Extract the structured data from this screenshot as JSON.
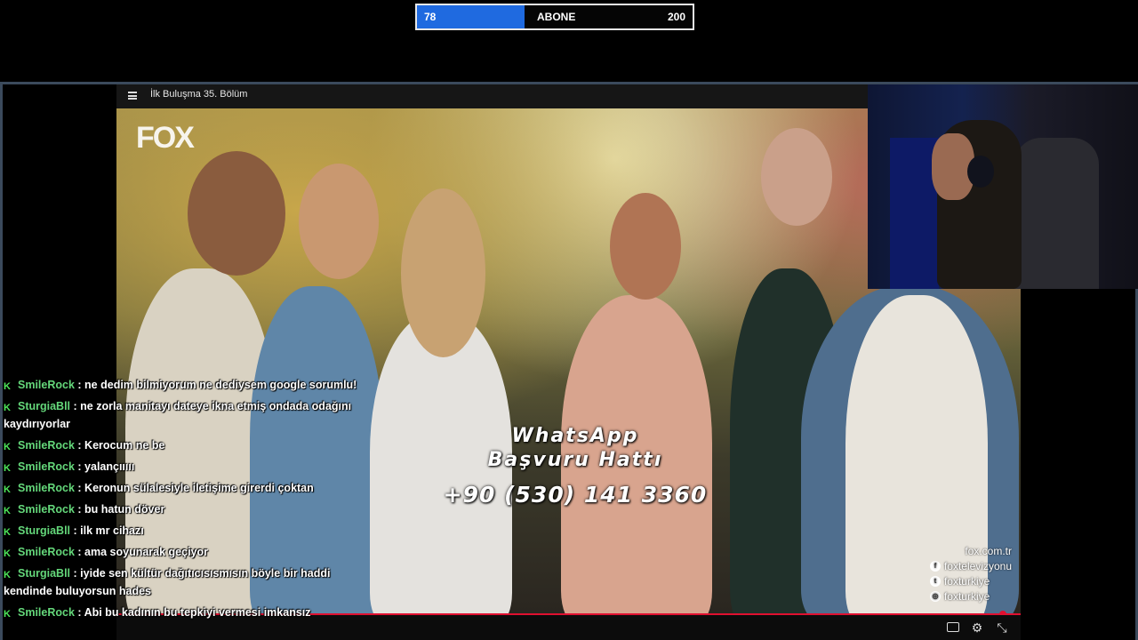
{
  "goal": {
    "current": "78",
    "label": "ABONE",
    "target": "200",
    "progress_fraction": 0.39,
    "fill_color": "#1f6ae0"
  },
  "player": {
    "title": "İlk Buluşma 35. Bölüm",
    "icons": [
      "menu-icon",
      "subtitles-icon",
      "gear-icon",
      "exit-fullscreen-icon"
    ],
    "progress_fraction": 0.98,
    "progress_color": "#e01030"
  },
  "video": {
    "channel_logo": "FOX",
    "overlay": {
      "line1": "WhatsApp",
      "line2": "Başvuru Hattı",
      "phone": "+90 (530) 141 3360"
    },
    "socials": {
      "site": "fox.com.tr",
      "facebook": "foxtelevizyonu",
      "twitter": "foxturkiye",
      "instagram": "foxturkiye"
    }
  },
  "chat": {
    "messages": [
      {
        "user": "SmileRock",
        "text": ": ne dedim bilmiyorum ne dediysem google sorumlu!"
      },
      {
        "user": "SturgiaBll",
        "text": ": ne zorla manitayı dateye ikna etmiş ondada odağını kaydırıyorlar"
      },
      {
        "user": "SmileRock",
        "text": ": Kerocum ne be"
      },
      {
        "user": "SmileRock",
        "text": ": yalançııııı"
      },
      {
        "user": "SmileRock",
        "text": ": Keronun sülalesiyle iletişime girerdi çoktan"
      },
      {
        "user": "SmileRock",
        "text": ": bu hatun döver"
      },
      {
        "user": "SturgiaBll",
        "text": ": ilk mr cihazı"
      },
      {
        "user": "SmileRock",
        "text": ": ama soyunarak geçiyor"
      },
      {
        "user": "SturgiaBll",
        "text": ": iyide sen kültür dağıtıcısısmısın böyle bir haddi kendinde buluyorsun hades"
      },
      {
        "user": "SmileRock",
        "text": ": Abi bu kadının bu tepkiyi vermesi imkansız"
      }
    ]
  }
}
